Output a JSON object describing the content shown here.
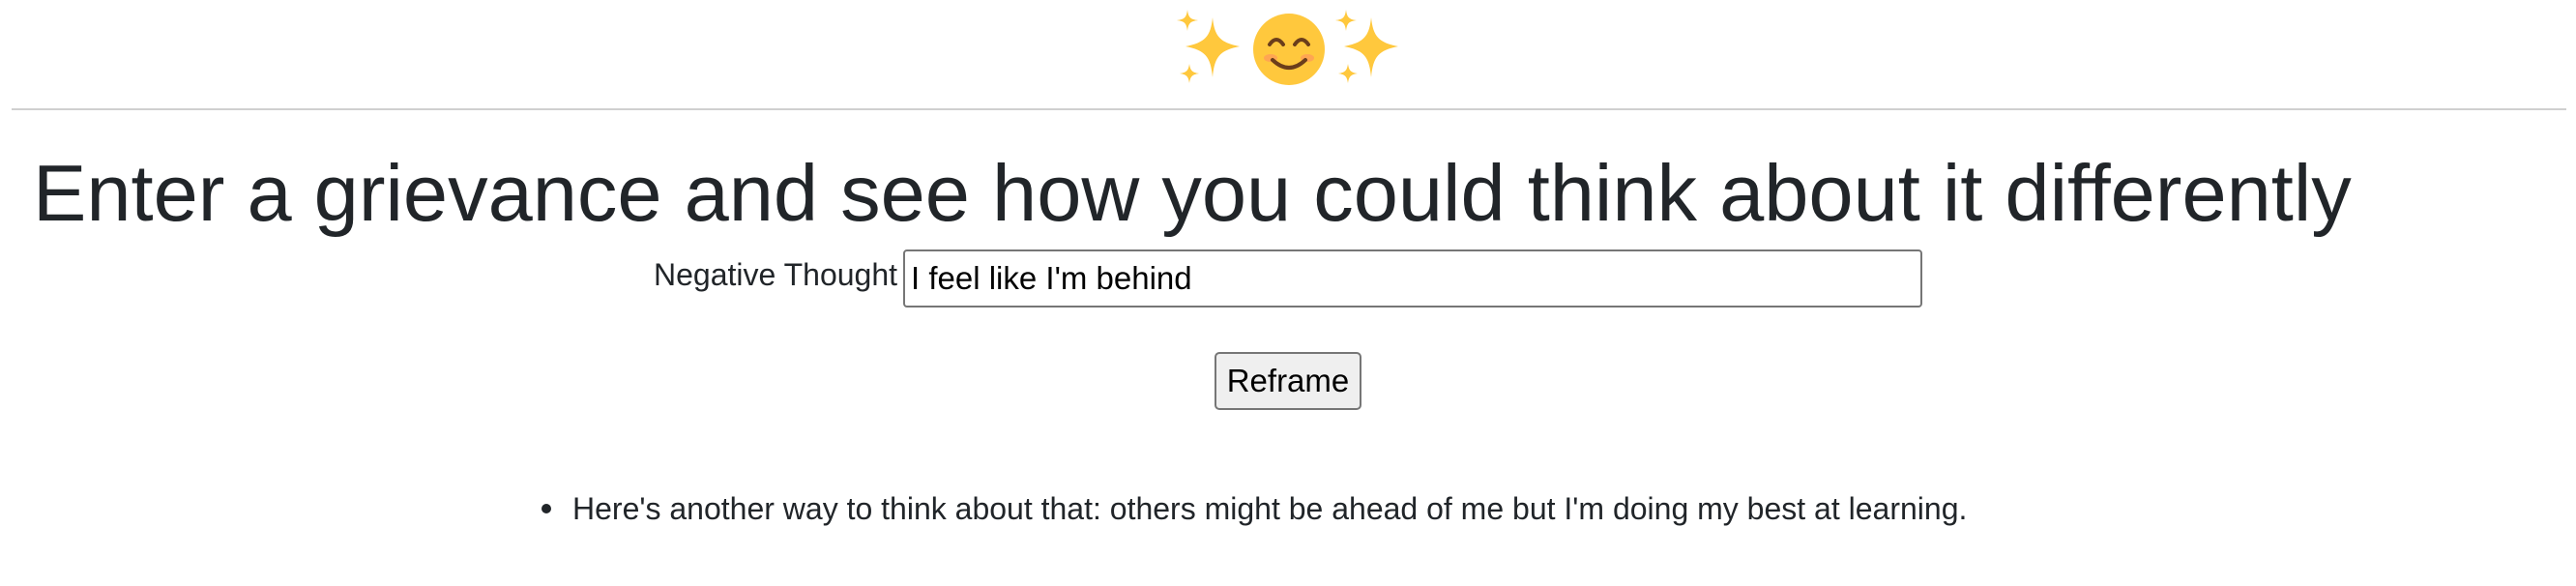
{
  "header": {
    "emoji_icons": [
      "sparkles-icon",
      "smiling-face-icon",
      "sparkles-icon"
    ],
    "colors": {
      "sparkle": "#FFC83D",
      "smiley_face": "#FFC83D",
      "smiley_features": "#6B3E1B",
      "smiley_blush": "#FF8A65"
    }
  },
  "main": {
    "title": "Enter a grievance and see how you could think about it differently",
    "form": {
      "label": "Negative Thought",
      "input_value": "I feel like I'm behind",
      "button_label": "Reframe"
    },
    "results": [
      "Here's another way to think about that: others might be ahead of me but I'm doing my best at learning."
    ]
  }
}
